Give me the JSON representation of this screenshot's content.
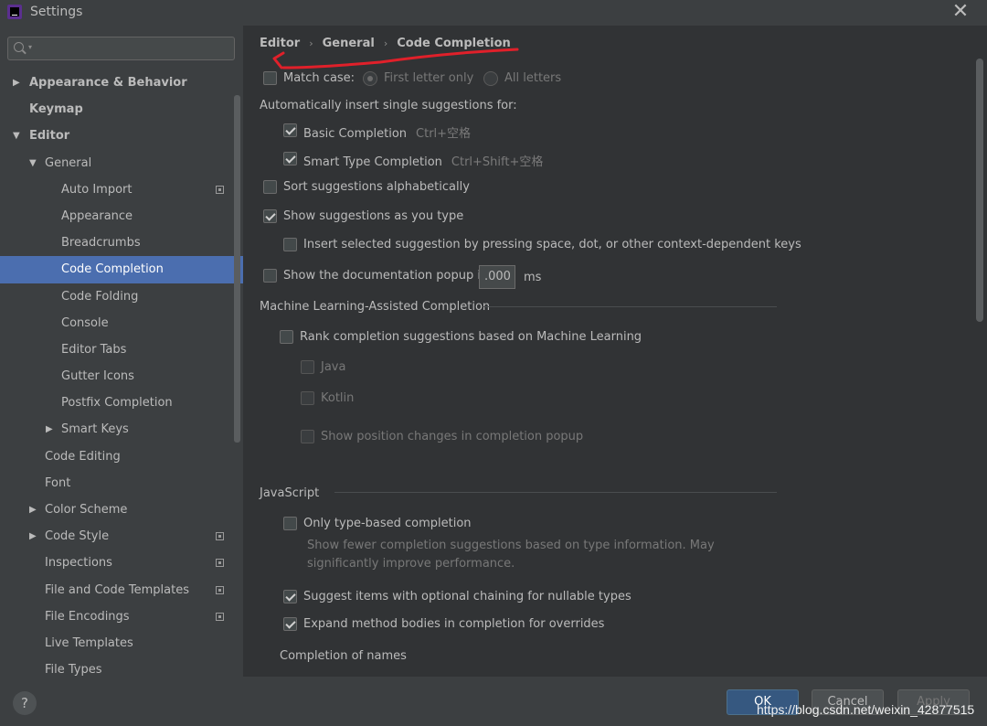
{
  "window": {
    "title": "Settings",
    "close_label": "✕"
  },
  "sidebar": {
    "search": {
      "value": "",
      "placeholder": ""
    },
    "items": [
      {
        "label": "Appearance & Behavior",
        "level": 0,
        "arrow": "▶",
        "bold": true
      },
      {
        "label": "Keymap",
        "level": 0,
        "arrow": "",
        "bold": true
      },
      {
        "label": "Editor",
        "level": 0,
        "arrow": "▼",
        "bold": true
      },
      {
        "label": "General",
        "level": 1,
        "arrow": "▼"
      },
      {
        "label": "Auto Import",
        "level": 2,
        "arrow": "",
        "project_icon": true
      },
      {
        "label": "Appearance",
        "level": 2,
        "arrow": ""
      },
      {
        "label": "Breadcrumbs",
        "level": 2,
        "arrow": ""
      },
      {
        "label": "Code Completion",
        "level": 2,
        "arrow": "",
        "selected": true
      },
      {
        "label": "Code Folding",
        "level": 2,
        "arrow": ""
      },
      {
        "label": "Console",
        "level": 2,
        "arrow": ""
      },
      {
        "label": "Editor Tabs",
        "level": 2,
        "arrow": ""
      },
      {
        "label": "Gutter Icons",
        "level": 2,
        "arrow": ""
      },
      {
        "label": "Postfix Completion",
        "level": 2,
        "arrow": ""
      },
      {
        "label": "Smart Keys",
        "level": 2,
        "arrow": "▶"
      },
      {
        "label": "Code Editing",
        "level": 1,
        "arrow": ""
      },
      {
        "label": "Font",
        "level": 1,
        "arrow": ""
      },
      {
        "label": "Color Scheme",
        "level": 1,
        "arrow": "▶"
      },
      {
        "label": "Code Style",
        "level": 1,
        "arrow": "▶",
        "project_icon": true
      },
      {
        "label": "Inspections",
        "level": 1,
        "arrow": "",
        "project_icon": true
      },
      {
        "label": "File and Code Templates",
        "level": 1,
        "arrow": "",
        "project_icon": true
      },
      {
        "label": "File Encodings",
        "level": 1,
        "arrow": "",
        "project_icon": true
      },
      {
        "label": "Live Templates",
        "level": 1,
        "arrow": ""
      },
      {
        "label": "File Types",
        "level": 1,
        "arrow": ""
      }
    ]
  },
  "breadcrumb": {
    "items": [
      "Editor",
      "General",
      "Code Completion"
    ],
    "separator": "›"
  },
  "settings": {
    "match_case": {
      "label": "Match case:",
      "checked": false
    },
    "first_letter": {
      "label": "First letter only",
      "selected": true
    },
    "all_letters": {
      "label": "All letters",
      "selected": false
    },
    "auto_insert_heading": "Automatically insert single suggestions for:",
    "basic_completion": {
      "label": "Basic Completion",
      "shortcut": "Ctrl+空格",
      "checked": true
    },
    "smart_type": {
      "label": "Smart Type Completion",
      "shortcut": "Ctrl+Shift+空格",
      "checked": true
    },
    "sort_alpha": {
      "label": "Sort suggestions alphabetically",
      "checked": false
    },
    "show_as_type": {
      "label": "Show suggestions as you type",
      "checked": true
    },
    "insert_selected": {
      "label": "Insert selected suggestion by pressing space, dot, or other context-dependent keys",
      "checked": false
    },
    "doc_popup": {
      "label": "Show the documentation popup in",
      "value": ".000",
      "unit": "ms",
      "checked": false
    },
    "ml_section": "Machine Learning-Assisted Completion",
    "ml_rank": {
      "label": "Rank completion suggestions based on Machine Learning",
      "checked": false
    },
    "ml_java": {
      "label": "Java",
      "checked": false
    },
    "ml_kotlin": {
      "label": "Kotlin",
      "checked": false
    },
    "ml_show_pos": {
      "label": "Show position changes in completion popup",
      "checked": false
    },
    "js_section": "JavaScript",
    "only_type_based": {
      "label": "Only type-based completion",
      "checked": false,
      "description_line1": "Show fewer completion suggestions based on type information. May",
      "description_line2": "significantly improve performance."
    },
    "optional_chaining": {
      "label": "Suggest items with optional chaining for nullable types",
      "checked": true
    },
    "expand_method": {
      "label": "Expand method bodies in completion for overrides",
      "checked": true
    },
    "completion_of_names": "Completion of names"
  },
  "buttons": {
    "help": "?",
    "ok": "OK",
    "cancel": "Cancel",
    "apply": "Apply"
  },
  "watermark": "https://blog.csdn.net/weixin_42877515",
  "colors": {
    "selection": "#4b6eaf",
    "annotation": "#e0202a",
    "ok_button": "#365880"
  }
}
